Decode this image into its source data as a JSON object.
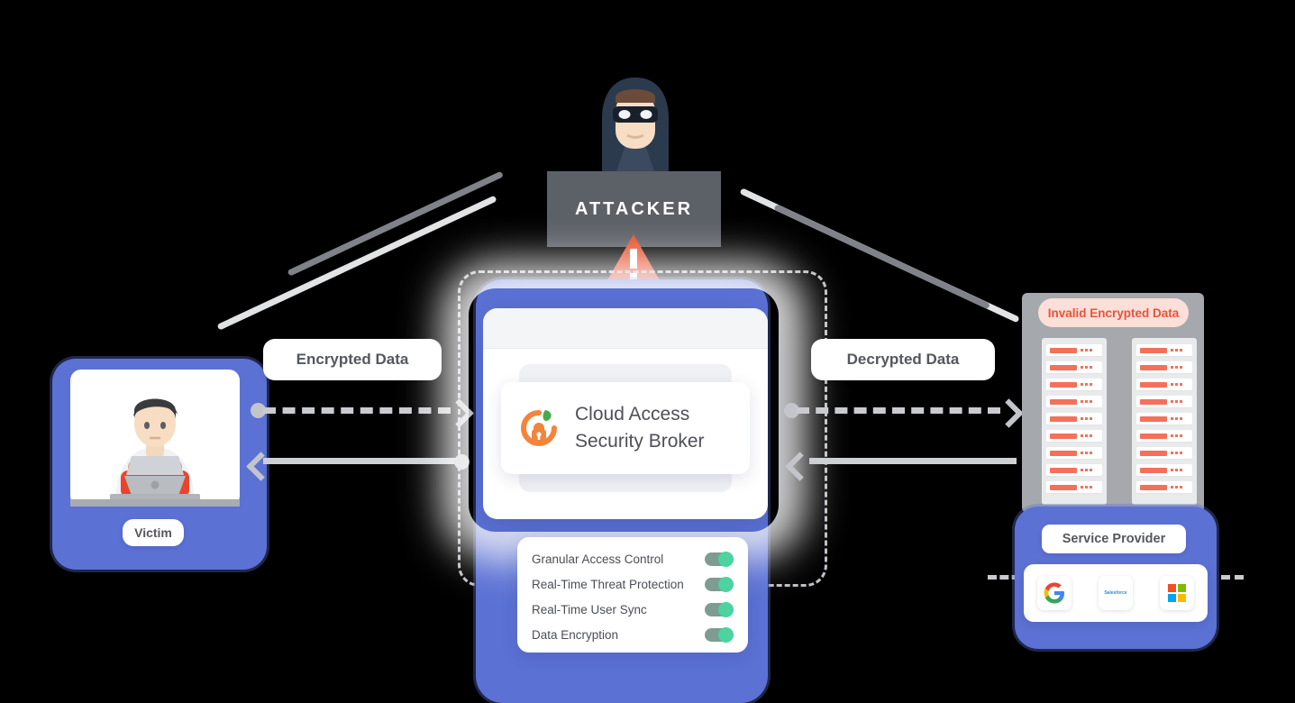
{
  "diagram": {
    "title": "Cloud Access Security Broker MITM protection diagram",
    "colors": {
      "blue_container": "#5b71d4",
      "attacker_banner": "#5c6067",
      "warning": "#e8512f",
      "toggle_on": "#4cd3a0",
      "invalid_pill_bg": "#fcdfd8",
      "invalid_pill_text": "#e8533a",
      "server_bar": "#f4705a",
      "line_gray": "#cdcfd3"
    }
  },
  "attacker": {
    "label": "ATTACKER",
    "icon": "hooded-masked-attacker-icon",
    "warning_icon": "warning-triangle-icon"
  },
  "victim": {
    "label": "Victim",
    "icon": "person-at-laptop-icon"
  },
  "casb": {
    "title_line1": "Cloud Access",
    "title_line2": "Security Broker",
    "logo_icon": "casb-padlock-leaf-icon",
    "features": [
      {
        "label": "Granular Access Control",
        "enabled": true
      },
      {
        "label": "Real-Time Threat Protection",
        "enabled": true
      },
      {
        "label": "Real-Time User Sync",
        "enabled": true
      },
      {
        "label": "Data Encryption",
        "enabled": true
      }
    ]
  },
  "flows": {
    "left_outbound": "Encrypted Data",
    "right_outbound": "Decrypted Data",
    "invalid": "Invalid Encrypted Data"
  },
  "service_provider": {
    "label": "Service Provider",
    "logos": [
      {
        "name": "google-logo",
        "text": ""
      },
      {
        "name": "salesforce-logo",
        "text": "Salesforce"
      },
      {
        "name": "microsoft-logo",
        "text": ""
      }
    ],
    "servers": {
      "racks": 2,
      "slots_per_rack": 9
    }
  }
}
